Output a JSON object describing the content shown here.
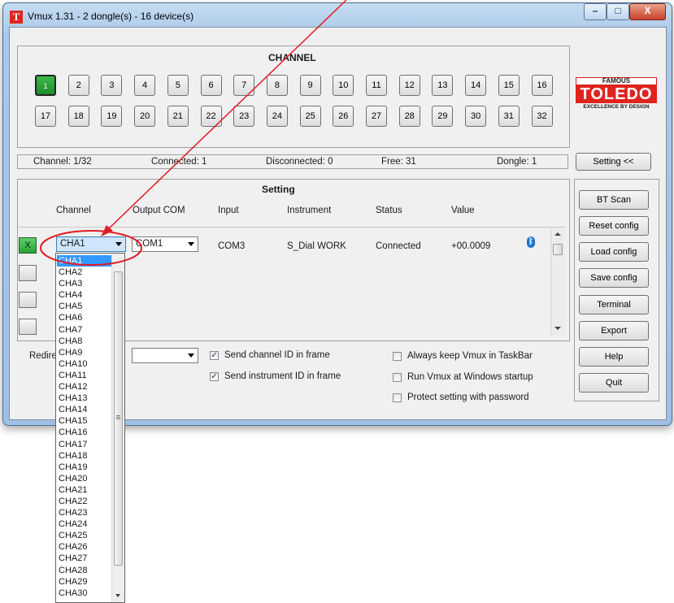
{
  "window": {
    "title": "Vmux 1.31 - 2 dongle(s) - 16 device(s)",
    "icon_letter": "T",
    "minimize": "–",
    "maximize": "□",
    "close": "X"
  },
  "channel_panel": {
    "title": "CHANNEL",
    "channels_row1": [
      "1",
      "2",
      "3",
      "4",
      "5",
      "6",
      "7",
      "8",
      "9",
      "10",
      "11",
      "12",
      "13",
      "14",
      "15",
      "16"
    ],
    "channels_row2": [
      "17",
      "18",
      "19",
      "20",
      "21",
      "22",
      "23",
      "24",
      "25",
      "26",
      "27",
      "28",
      "29",
      "30",
      "31",
      "32"
    ],
    "active_channel": "1"
  },
  "logo": {
    "line1": "FAMOUS",
    "line2": "TOLEDO",
    "line3": "EXCELLENCE BY DESIGN"
  },
  "status": {
    "channel": "Channel: 1/32",
    "connected": "Connected: 1",
    "disconnected": "Disconnected: 0",
    "free": "Free: 31",
    "dongle": "Dongle: 1"
  },
  "setting_toggle": "Setting <<",
  "setting_panel": {
    "title": "Setting",
    "headers": {
      "channel": "Channel",
      "output_com": "Output COM",
      "input": "Input",
      "instrument": "Instrument",
      "status": "Status",
      "value": "Value"
    },
    "row1": {
      "marker": "X",
      "channel": "CHA1",
      "output_com": "COM1",
      "input": "COM3",
      "instrument": "S_Dial WORK",
      "status": "Connected",
      "value": "+00.0009",
      "bluetooth_icon": "bluetooth-icon"
    }
  },
  "dropdown": {
    "items": [
      "CHA1",
      "CHA2",
      "CHA3",
      "CHA4",
      "CHA5",
      "CHA6",
      "CHA7",
      "CHA8",
      "CHA9",
      "CHA10",
      "CHA11",
      "CHA12",
      "CHA13",
      "CHA14",
      "CHA15",
      "CHA16",
      "CHA17",
      "CHA18",
      "CHA19",
      "CHA20",
      "CHA21",
      "CHA22",
      "CHA23",
      "CHA24",
      "CHA25",
      "CHA26",
      "CHA27",
      "CHA28",
      "CHA29",
      "CHA30"
    ],
    "selected": "CHA1"
  },
  "options": {
    "redirect_label": "Redire",
    "send_channel_id": "Send channel ID in frame",
    "send_instrument_id": "Send instrument ID in frame",
    "always_keep": "Always keep Vmux in TaskBar",
    "run_startup": "Run Vmux at Windows startup",
    "protect_password": "Protect setting with password",
    "send_channel_checked": true,
    "send_instrument_checked": true
  },
  "side_buttons": {
    "bt_scan": "BT Scan",
    "reset_config": "Reset config",
    "load_config": "Load config",
    "save_config": "Save config",
    "terminal": "Terminal",
    "export": "Export",
    "help": "Help",
    "quit": "Quit"
  },
  "annotation_color": "#e01b24",
  "accent_green": "#2aa33a"
}
